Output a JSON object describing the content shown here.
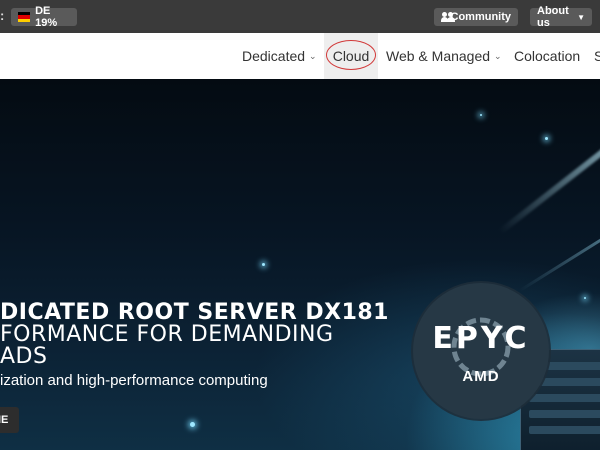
{
  "topbar": {
    "vat_label": "DE 19%",
    "community_label": "Community",
    "about_label": "About us"
  },
  "nav": {
    "items": [
      {
        "label": "Dedicated",
        "has_dropdown": true
      },
      {
        "label": "Cloud",
        "has_dropdown": false,
        "active": true
      },
      {
        "label": "Web & Managed",
        "has_dropdown": true
      },
      {
        "label": "Colocation",
        "has_dropdown": false
      },
      {
        "label": "S",
        "has_dropdown": false
      }
    ]
  },
  "hero": {
    "title_line1": "DICATED ROOT SERVER DX181",
    "title_line2": "FORMANCE FOR DEMANDING",
    "title_line3": "ADS",
    "subtitle": "ization and high-performance computing",
    "button_label": "IE",
    "badge_main": "EPYC",
    "badge_brand": "AMD"
  },
  "colors": {
    "topbar_bg": "#3a3a3a",
    "pill_bg": "#5a5a5a",
    "nav_bg": "#ffffff",
    "highlight_circle": "#d23a3a",
    "hero_bg": "#081622"
  }
}
